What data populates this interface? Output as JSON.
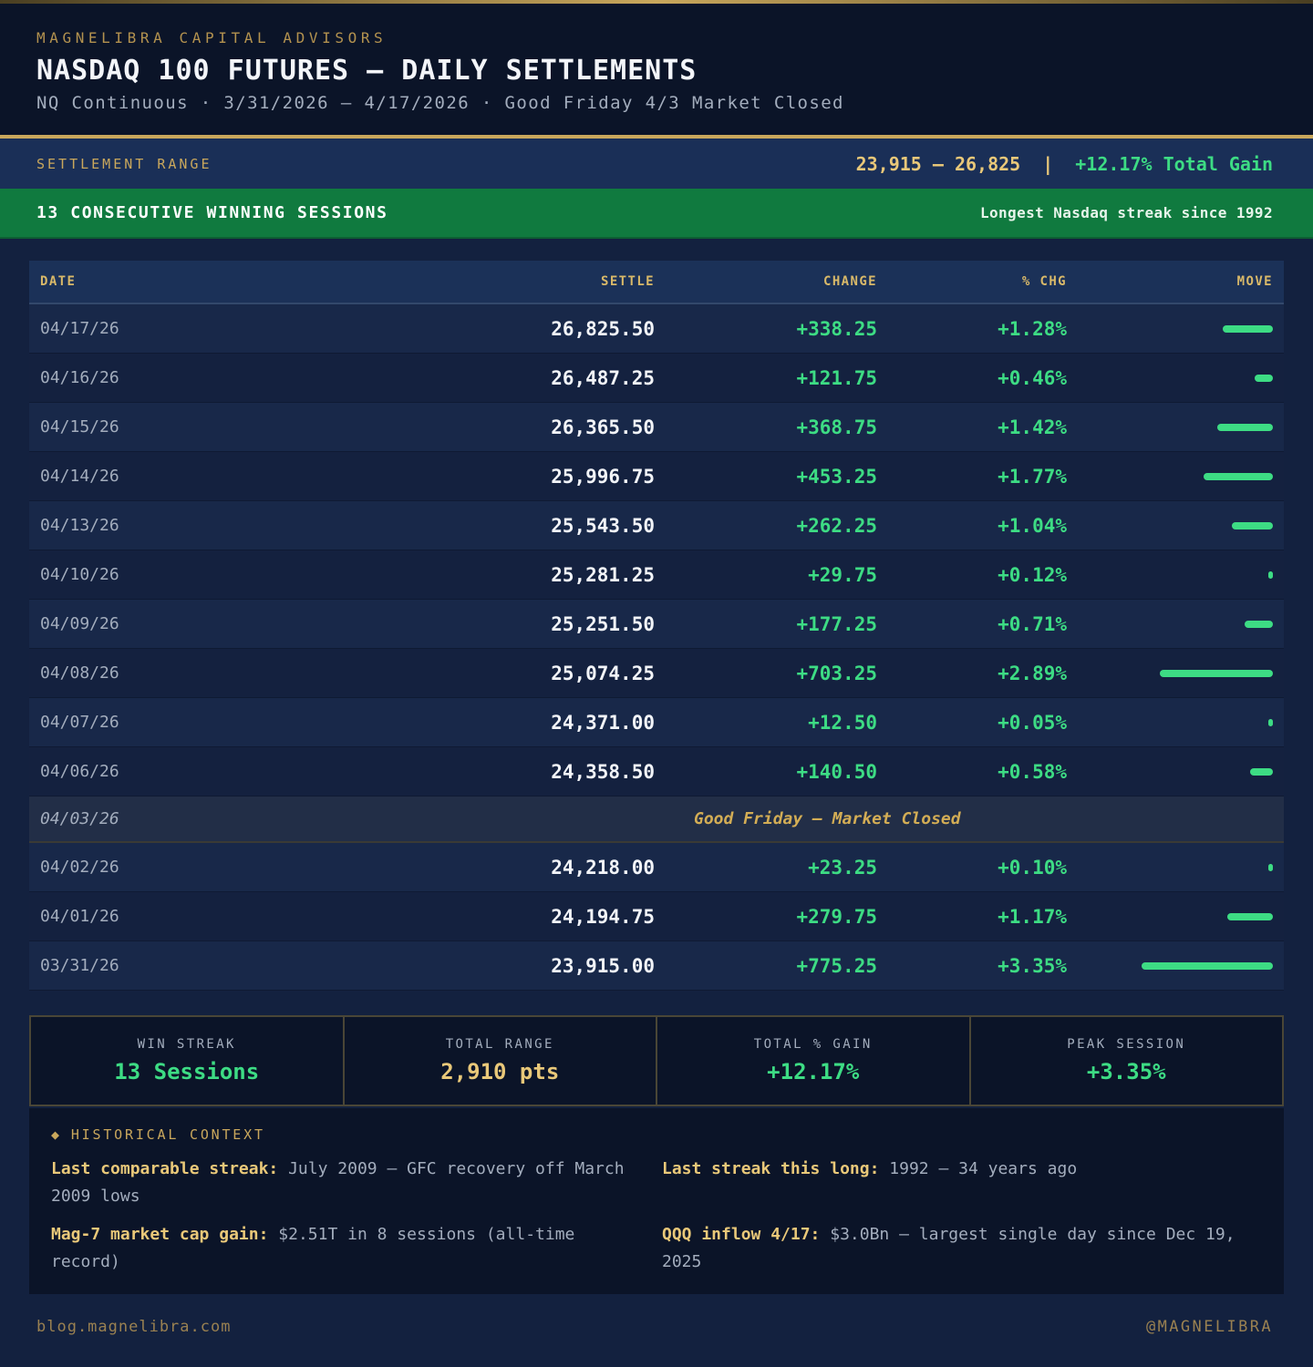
{
  "header": {
    "brand": "MAGNELIBRA CAPITAL ADVISORS",
    "title": "NASDAQ 100 FUTURES — DAILY SETTLEMENTS",
    "subtitle": "NQ Continuous · 3/31/2026 — 4/17/2026 · Good Friday 4/3 Market Closed"
  },
  "range_bar": {
    "label": "SETTLEMENT RANGE",
    "range": "23,915 — 26,825",
    "separator": "|",
    "gain": "+12.17% Total Gain"
  },
  "streak_banner": {
    "left": "13 CONSECUTIVE WINNING SESSIONS",
    "right": "Longest Nasdaq streak since 1992"
  },
  "table": {
    "columns": [
      "DATE",
      "SETTLE",
      "CHANGE",
      "% CHG",
      "MOVE"
    ],
    "rows": [
      {
        "date": "04/17/26",
        "settle": "26,825.50",
        "change": "+338.25",
        "pct": "+1.28%",
        "move": 1.28
      },
      {
        "date": "04/16/26",
        "settle": "26,487.25",
        "change": "+121.75",
        "pct": "+0.46%",
        "move": 0.46
      },
      {
        "date": "04/15/26",
        "settle": "26,365.50",
        "change": "+368.75",
        "pct": "+1.42%",
        "move": 1.42
      },
      {
        "date": "04/14/26",
        "settle": "25,996.75",
        "change": "+453.25",
        "pct": "+1.77%",
        "move": 1.77
      },
      {
        "date": "04/13/26",
        "settle": "25,543.50",
        "change": "+262.25",
        "pct": "+1.04%",
        "move": 1.04
      },
      {
        "date": "04/10/26",
        "settle": "25,281.25",
        "change": "+29.75",
        "pct": "+0.12%",
        "move": 0.12
      },
      {
        "date": "04/09/26",
        "settle": "25,251.50",
        "change": "+177.25",
        "pct": "+0.71%",
        "move": 0.71
      },
      {
        "date": "04/08/26",
        "settle": "25,074.25",
        "change": "+703.25",
        "pct": "+2.89%",
        "move": 2.89
      },
      {
        "date": "04/07/26",
        "settle": "24,371.00",
        "change": "+12.50",
        "pct": "+0.05%",
        "move": 0.05
      },
      {
        "date": "04/06/26",
        "settle": "24,358.50",
        "change": "+140.50",
        "pct": "+0.58%",
        "move": 0.58
      },
      {
        "date": "04/03/26",
        "closed": true,
        "note": "Good Friday — Market Closed"
      },
      {
        "date": "04/02/26",
        "settle": "24,218.00",
        "change": "+23.25",
        "pct": "+0.10%",
        "move": 0.1
      },
      {
        "date": "04/01/26",
        "settle": "24,194.75",
        "change": "+279.75",
        "pct": "+1.17%",
        "move": 1.17
      },
      {
        "date": "03/31/26",
        "settle": "23,915.00",
        "change": "+775.25",
        "pct": "+3.35%",
        "move": 3.35
      }
    ]
  },
  "stats": [
    {
      "label": "WIN STREAK",
      "value": "13 Sessions",
      "tone": "green"
    },
    {
      "label": "TOTAL RANGE",
      "value": "2,910 pts",
      "tone": "gold"
    },
    {
      "label": "TOTAL % GAIN",
      "value": "+12.17%",
      "tone": "green"
    },
    {
      "label": "PEAK SESSION",
      "value": "+3.35%",
      "tone": "green"
    }
  ],
  "history": {
    "title": "HISTORICAL CONTEXT",
    "items": [
      {
        "label": "Last comparable streak:",
        "text": "July 2009 — GFC recovery off March 2009 lows"
      },
      {
        "label": "Last streak this long:",
        "text": "1992 — 34 years ago"
      },
      {
        "label": "Mag-7 market cap gain:",
        "text": "$2.51T in 8 sessions (all-time record)"
      },
      {
        "label": "QQQ inflow 4/17:",
        "text": "$3.0Bn — largest single day since Dec 19, 2025"
      }
    ]
  },
  "footer": {
    "left": "blog.magnelibra.com",
    "right": "@MAGNELIBRA"
  },
  "colors": {
    "gain_green": "#3ddc84",
    "gold": "#c9a75c",
    "banner_green": "#107a3f"
  }
}
